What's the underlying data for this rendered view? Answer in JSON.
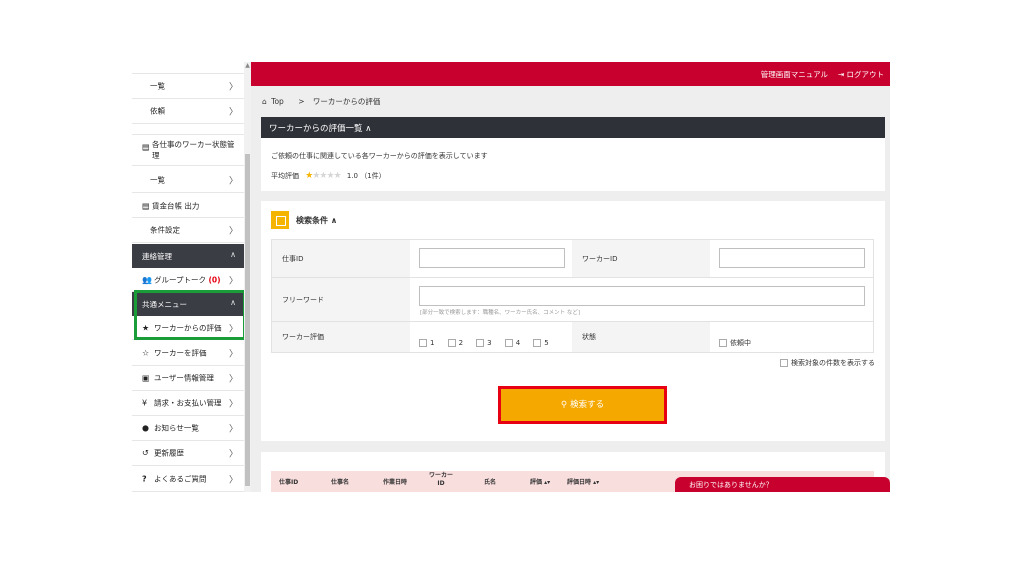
{
  "sidebar": {
    "items": [
      {
        "label": "一覧"
      },
      {
        "label": "依頼"
      },
      {
        "label": "各仕事のワーカー状態管理"
      },
      {
        "label": "一覧"
      },
      {
        "label": "賃金台帳 出力"
      },
      {
        "label": "条件設定"
      }
    ],
    "section_contact": "連絡管理",
    "group_talk": {
      "label": "グループトーク",
      "count": "(0)"
    },
    "section_common": "共通メニュー",
    "menu": [
      {
        "label": "ワーカーからの評価",
        "icon": "star-filled-icon"
      },
      {
        "label": "ワーカーを評価",
        "icon": "star-outline-icon"
      },
      {
        "label": "ユーザー情報管理",
        "icon": "user-card-icon"
      },
      {
        "label": "請求・お支払い管理",
        "icon": "yen-icon"
      },
      {
        "label": "お知らせ一覧",
        "icon": "info-icon"
      },
      {
        "label": "更新履歴",
        "icon": "history-icon"
      },
      {
        "label": "よくあるご質問",
        "icon": "question-icon"
      }
    ]
  },
  "topbar": {
    "manual": "管理画面マニュアル",
    "logout": "ログアウト"
  },
  "breadcrumb": {
    "home": "Top",
    "sep": ">",
    "current": "ワーカーからの評価"
  },
  "evaluation": {
    "header": "ワーカーからの評価一覧 ∧",
    "description": "ご依頼の仕事に関連している各ワーカーからの評価を表示しています",
    "avg_label": "平均評価",
    "avg_value": "1.0 （1件）",
    "stars_filled": 1,
    "stars_total": 5
  },
  "search": {
    "title": "検索条件 ∧",
    "job_id_label": "仕事ID",
    "worker_id_label": "ワーカーID",
    "freeword_label": "フリーワード",
    "freeword_hint": "[部分一致で検索します：職種名、ワーカー氏名、コメント など]",
    "rating_label": "ワーカー評価",
    "ratings": [
      "1",
      "2",
      "3",
      "4",
      "5"
    ],
    "status_label": "状態",
    "status_option": "依頼中",
    "show_count_label": "検索対象の件数を表示する",
    "button": "検索する"
  },
  "results": {
    "columns": [
      "仕事ID",
      "仕事名",
      "作業日時",
      "ワーカー ID",
      "氏名",
      "評価 ▴▾",
      "評価日時 ▴▾"
    ]
  },
  "help_tab": "お困りではありませんか？",
  "colors": {
    "brand_red": "#c8002d",
    "accent_orange": "#f5a800",
    "dark": "#2e3138",
    "highlight_green": "#1a9c39"
  }
}
